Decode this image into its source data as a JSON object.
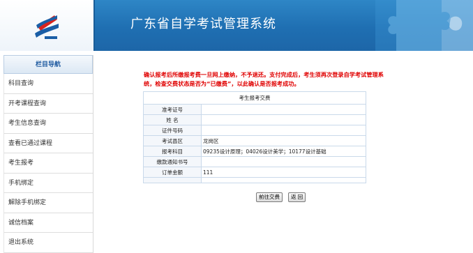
{
  "header": {
    "title": "广东省自学考试管理系统",
    "brand_color": "#1f6fb2"
  },
  "sidebar": {
    "heading": "栏目导航",
    "items": [
      {
        "label": "科目查询"
      },
      {
        "label": "开考课程查询"
      },
      {
        "label": "考生信息查询"
      },
      {
        "label": "查看已通过课程"
      },
      {
        "label": "考生报考"
      },
      {
        "label": "手机绑定"
      },
      {
        "label": "解除手机绑定"
      },
      {
        "label": "诚信档案"
      },
      {
        "label": "退出系统"
      }
    ]
  },
  "notice": {
    "text": "确认报考后所缴报考费一旦网上缴纳，不予退还。支付完成后，考生须再次登录自学考试管理系统，检查交费状态是否为“已缴费”，以此确认是否报考成功。",
    "color": "#e00000"
  },
  "form": {
    "caption": "考生报考交费",
    "rows": [
      {
        "label": "准考证号",
        "value": ""
      },
      {
        "label": "姓 名",
        "value": ""
      },
      {
        "label": "证件号码",
        "value": ""
      },
      {
        "label": "考试县区",
        "value": "龙岗区"
      },
      {
        "label": "报考科目",
        "value": "09235设计原理；04026设计美学；10177设计基础"
      },
      {
        "label": "缴款通知书号",
        "value": ""
      },
      {
        "label": "订单金额",
        "value": "111"
      }
    ]
  },
  "buttons": {
    "pay": "前往交费",
    "back": "返 回"
  }
}
